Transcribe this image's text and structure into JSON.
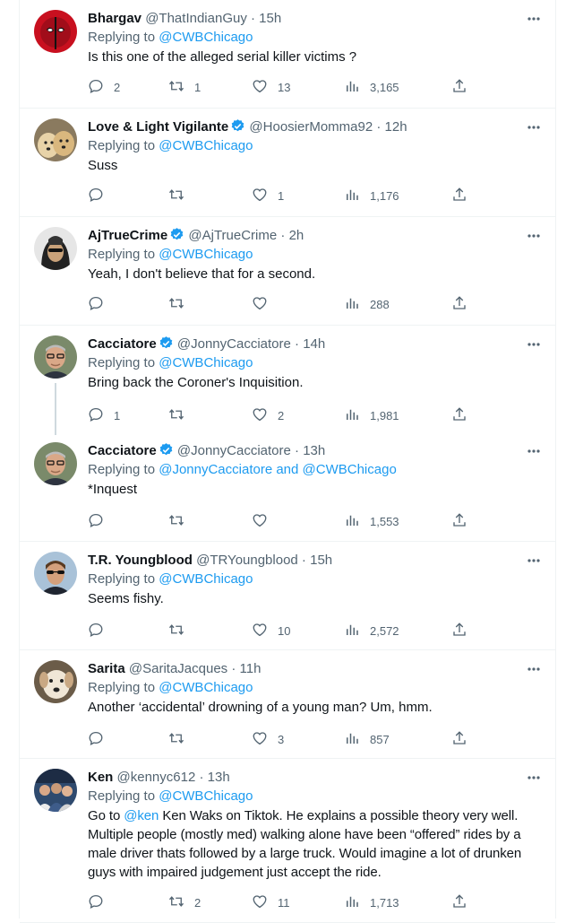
{
  "tweets": [
    {
      "name": "Bhargav",
      "handle": "@ThatIndianGuy",
      "time": "15h",
      "verified": false,
      "reply_prefix": "Replying to ",
      "reply_to": "@CWBChicago",
      "text": "Is this one of the alleged serial killer victims ?",
      "replies": "2",
      "retweets": "1",
      "likes": "13",
      "views": "3,165",
      "avatar_icon": "deadpool-avatar-icon"
    },
    {
      "name": "Love & Light Vigilante",
      "handle": "@HoosierMomma92",
      "time": "12h",
      "verified": true,
      "reply_prefix": "Replying to ",
      "reply_to": "@CWBChicago",
      "text": "Suss",
      "replies": "",
      "retweets": "",
      "likes": "1",
      "views": "1,176",
      "avatar_icon": "dogs-avatar-icon"
    },
    {
      "name": "AjTrueCrime",
      "handle": "@AjTrueCrime",
      "time": "2h",
      "verified": true,
      "reply_prefix": "Replying to ",
      "reply_to": "@CWBChicago",
      "text": "Yeah, I don't believe that for a second.",
      "replies": "",
      "retweets": "",
      "likes": "",
      "views": "288",
      "avatar_icon": "hooded-person-avatar-icon"
    },
    {
      "name": "Cacciatore",
      "handle": "@JonnyCacciatore",
      "time": "14h",
      "verified": true,
      "reply_prefix": "Replying to ",
      "reply_to": "@CWBChicago",
      "text": "Bring back the Coroner's Inquisition.",
      "replies": "1",
      "retweets": "",
      "likes": "2",
      "views": "1,981",
      "avatar_icon": "man-glasses-avatar-icon"
    },
    {
      "name": "Cacciatore",
      "handle": "@JonnyCacciatore",
      "time": "13h",
      "verified": true,
      "reply_prefix": "Replying to ",
      "reply_to": "@JonnyCacciatore and @CWBChicago",
      "text": "*Inquest",
      "replies": "",
      "retweets": "",
      "likes": "",
      "views": "1,553",
      "avatar_icon": "man-glasses-avatar-icon"
    },
    {
      "name": "T.R. Youngblood",
      "handle": "@TRYoungblood",
      "time": "15h",
      "verified": false,
      "reply_prefix": "Replying to ",
      "reply_to": "@CWBChicago",
      "text": "Seems fishy.",
      "replies": "",
      "retweets": "",
      "likes": "10",
      "views": "2,572",
      "avatar_icon": "man-sunglasses-avatar-icon"
    },
    {
      "name": "Sarita",
      "handle": "@SaritaJacques",
      "time": "11h",
      "verified": false,
      "reply_prefix": "Replying to ",
      "reply_to": "@CWBChicago",
      "text": "Another ‘accidental’ drowning of a young man? Um, hmm.",
      "replies": "",
      "retweets": "",
      "likes": "3",
      "views": "857",
      "avatar_icon": "dog-avatar-icon"
    },
    {
      "name": "Ken",
      "handle": "@kennyc612",
      "time": "13h",
      "verified": false,
      "reply_prefix": "Replying to ",
      "reply_to": "@CWBChicago",
      "text_mention": "@ken",
      "text": " Ken Waks on Tiktok. He explains a possible theory very well. Multiple people (mostly med) walking alone have been “offered” rides by a male driver thats followed by a large truck. Would imagine a lot of drunken guys with impaired judgement just accept the ride.",
      "text_prefix": "Go to ",
      "replies": "",
      "retweets": "2",
      "likes": "11",
      "views": "1,713",
      "avatar_icon": "group-photo-avatar-icon"
    }
  ],
  "colors": {
    "link": "#1d9bf0",
    "muted": "#536471",
    "verified": "#1d9bf0",
    "divider": "#eff3f4"
  },
  "icons": {
    "reply": "reply-icon",
    "retweet": "retweet-icon",
    "like": "heart-icon",
    "views": "views-icon",
    "share": "share-icon",
    "more": "more-icon"
  }
}
